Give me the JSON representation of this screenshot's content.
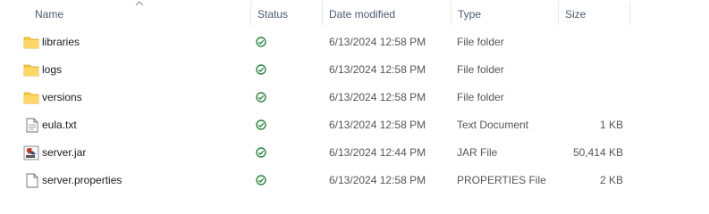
{
  "columns": {
    "name": "Name",
    "status": "Status",
    "date_modified": "Date modified",
    "type": "Type",
    "size": "Size"
  },
  "rows": [
    {
      "name": "libraries",
      "icon": "folder-icon",
      "status": "available-locally-icon",
      "date": "6/13/2024 12:58 PM",
      "type": "File folder",
      "size": ""
    },
    {
      "name": "logs",
      "icon": "folder-icon",
      "status": "available-locally-icon",
      "date": "6/13/2024 12:58 PM",
      "type": "File folder",
      "size": ""
    },
    {
      "name": "versions",
      "icon": "folder-icon",
      "status": "available-locally-icon",
      "date": "6/13/2024 12:58 PM",
      "type": "File folder",
      "size": ""
    },
    {
      "name": "eula.txt",
      "icon": "text-file-icon",
      "status": "available-locally-icon",
      "date": "6/13/2024 12:58 PM",
      "type": "Text Document",
      "size": "1 KB"
    },
    {
      "name": "server.jar",
      "icon": "jar-file-icon",
      "status": "available-locally-icon",
      "date": "6/13/2024 12:44 PM",
      "type": "JAR File",
      "size": "50,414 KB"
    },
    {
      "name": "server.properties",
      "icon": "generic-file-icon",
      "status": "available-locally-icon",
      "date": "6/13/2024 12:58 PM",
      "type": "PROPERTIES File",
      "size": "2 KB"
    }
  ],
  "colors": {
    "folder": "#f8c843",
    "status_green": "#2e8540",
    "header_text": "#4a5a6e"
  }
}
